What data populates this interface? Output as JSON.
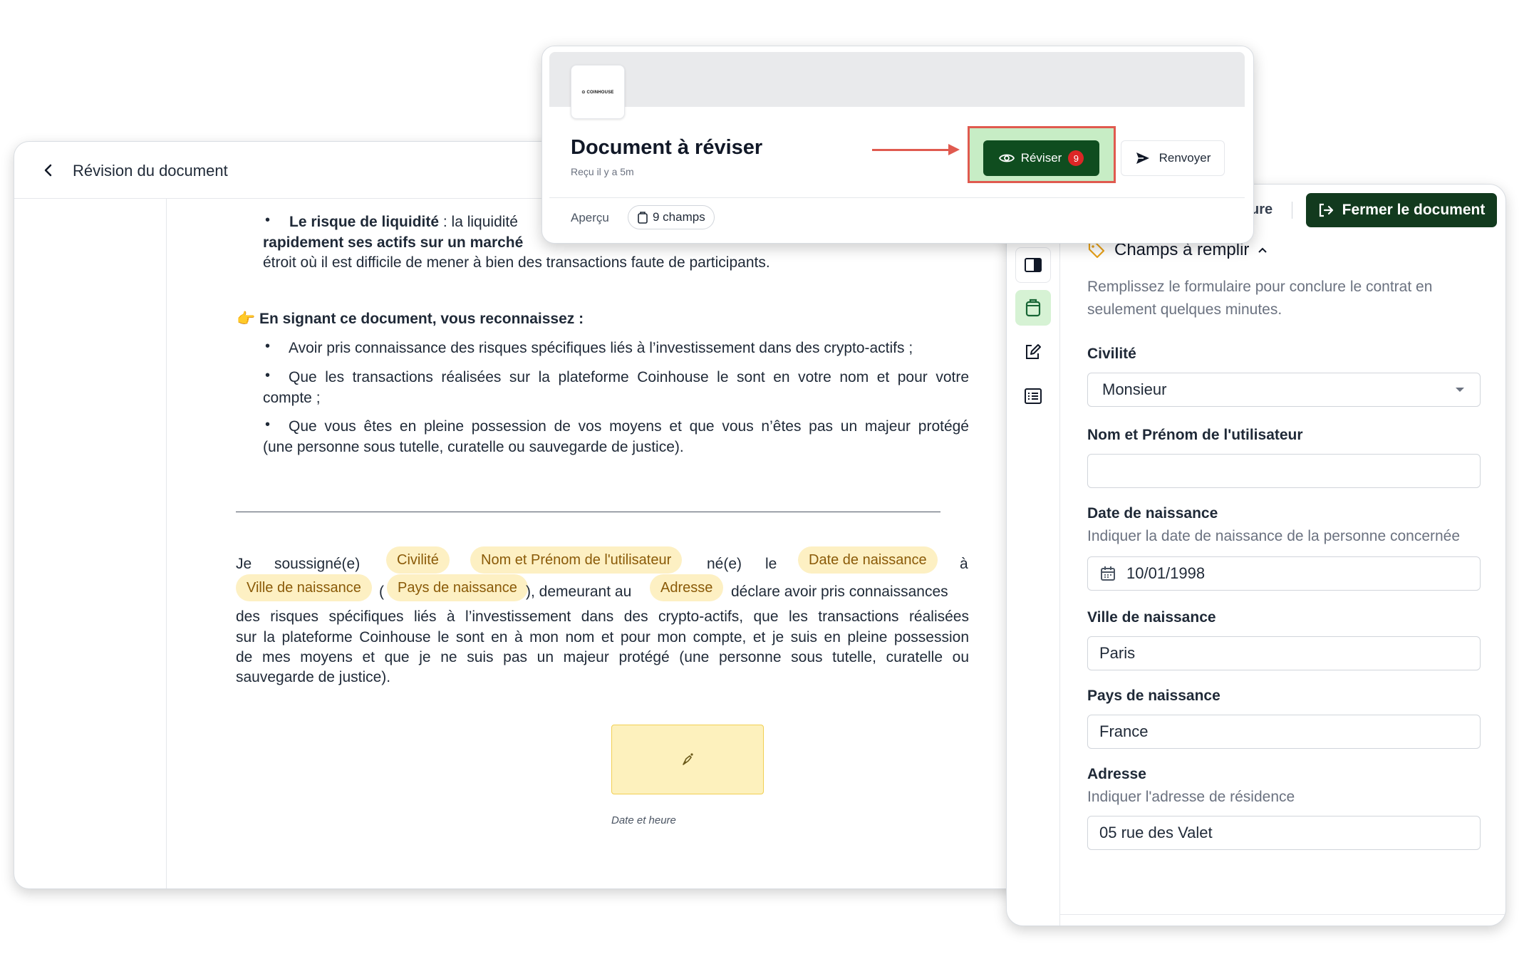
{
  "doc": {
    "title": "Révision du document",
    "liquidity_bold": "Le risque de liquidité",
    "liquidity_colon": ": la liquidité",
    "liquidity_line2": "rapidement ses actifs sur un marché",
    "liquidity_line3": "étroit où il est difficile de mener à bien des transactions faute de participants.",
    "ack_emoji": "👉",
    "ack_heading": "En signant ce document, vous reconnaissez :",
    "bullets": [
      "Avoir pris connaissance des risques spécifiques liés à l’investissement dans des crypto-actifs ;",
      "Que les transactions réalisées sur la plateforme Coinhouse le sont en votre nom et pour votre",
      "Que vous êtes en pleine possession de vos moyens et que vous n’êtes pas un majeur protégé"
    ],
    "bullet2_cont": "compte ;",
    "bullet3_cont": "(une personne sous tutelle, curatelle ou sauvegarde de justice).",
    "decl_je": "Je",
    "decl_soussigne": "soussigné(e)",
    "decl_ne": "né(e)",
    "decl_le": "le",
    "decl_a": "à",
    "decl_paren": "(",
    "decl_demeurant": "), demeurant au",
    "decl_declare": "déclare avoir pris connaissances",
    "decl_lines": [
      "des risques spécifiques liés à l’investissement dans des crypto-actifs, que les transactions réalisées",
      "sur la plateforme Coinhouse le sont en à mon nom et pour mon compte, et je suis en pleine possession",
      "de mes moyens et que je ne suis pas un majeur protégé (une personne sous tutelle, curatelle ou"
    ],
    "decl_last": "sauvegarde de justice).",
    "pills": {
      "civilite": "Civilité",
      "nom": "Nom et Prénom de l'utilisateur",
      "date": "Date de naissance",
      "ville": "Ville de naissance",
      "pays": "Pays de naissance",
      "adresse": "Adresse"
    },
    "signature_label": "Date et heure"
  },
  "popup": {
    "logo": "⊙ COINHOUSE",
    "title": "Document à réviser",
    "subtitle": "Reçu il y a 5m",
    "reviser_label": "Réviser",
    "reviser_count": "9",
    "renvoyer_label": "Renvoyer",
    "apercu_label": "Aperçu",
    "champs_chip": "9 champs"
  },
  "panel": {
    "ghost_button_partial": "ure",
    "fermer_label": "Fermer le document",
    "section_title": "Champs à remplir",
    "section_desc_1": "Remplissez le formulaire pour conclure le contrat en",
    "section_desc_2": "seulement quelques minutes.",
    "fields": {
      "civilite_label": "Civilité",
      "civilite_value": "Monsieur",
      "nom_label": "Nom et Prénom de l'utilisateur",
      "nom_value": "",
      "date_label": "Date de naissance",
      "date_help": "Indiquer la date de naissance de la personne concernée",
      "date_value": "10/01/1998",
      "ville_label": "Ville de naissance",
      "ville_value": "Paris",
      "pays_label": "Pays de naissance",
      "pays_value": "France",
      "adresse_label": "Adresse",
      "adresse_help": "Indiquer l'adresse de résidence",
      "adresse_value": "05 rue des Valet"
    }
  },
  "colors": {
    "brand_dark_green": "#123a1e",
    "reviser_green": "#0f4d1f",
    "highlight_red": "#e05a4f",
    "pill_bg": "#fdf0c3",
    "pill_text": "#8a5a08"
  }
}
